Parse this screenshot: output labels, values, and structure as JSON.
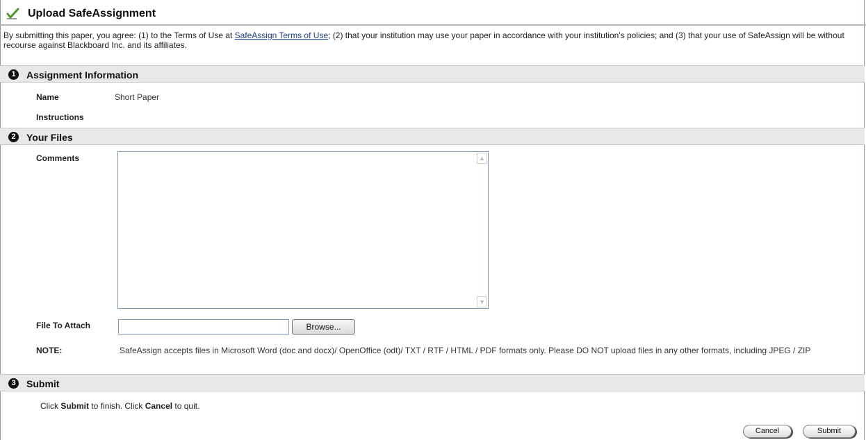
{
  "header": {
    "title": "Upload SafeAssignment",
    "icon": "check-mark-icon"
  },
  "agreement": {
    "before_link": "By submitting this paper, you agree: (1) to the Terms of Use at ",
    "link_text": "SafeAssign Terms of Use",
    "after_link": "; (2) that your institution may use your paper in accordance with your institution's policies; and (3) that your use of SafeAssign will be without recourse against Blackboard Inc. and its affiliates."
  },
  "sections": [
    {
      "number": "1",
      "label": "Assignment Information"
    },
    {
      "number": "2",
      "label": "Your Files"
    },
    {
      "number": "3",
      "label": "Submit"
    }
  ],
  "assignment": {
    "name_label": "Name",
    "name_value": "Short Paper",
    "instructions_label": "Instructions"
  },
  "files": {
    "comments_label": "Comments",
    "comments_value": "",
    "file_label": "File To Attach",
    "file_value": "",
    "browse_label": "Browse...",
    "note_label": "NOTE:",
    "note_text": "SafeAssign accepts files in Microsoft Word (doc and docx)/ OpenOffice (odt)/ TXT / RTF / HTML / PDF formats only. Please DO NOT upload files in any other formats, including JPEG / ZIP"
  },
  "submit": {
    "text_1": "Click ",
    "bold_1": "Submit",
    "text_2": " to finish. Click ",
    "bold_2": "Cancel",
    "text_3": " to quit.",
    "cancel_label": "Cancel",
    "submit_label": "Submit"
  },
  "colors": {
    "link": "#1a3e8c",
    "section_bg": "#e8e8e8",
    "check_green": "#4a9a2a"
  }
}
